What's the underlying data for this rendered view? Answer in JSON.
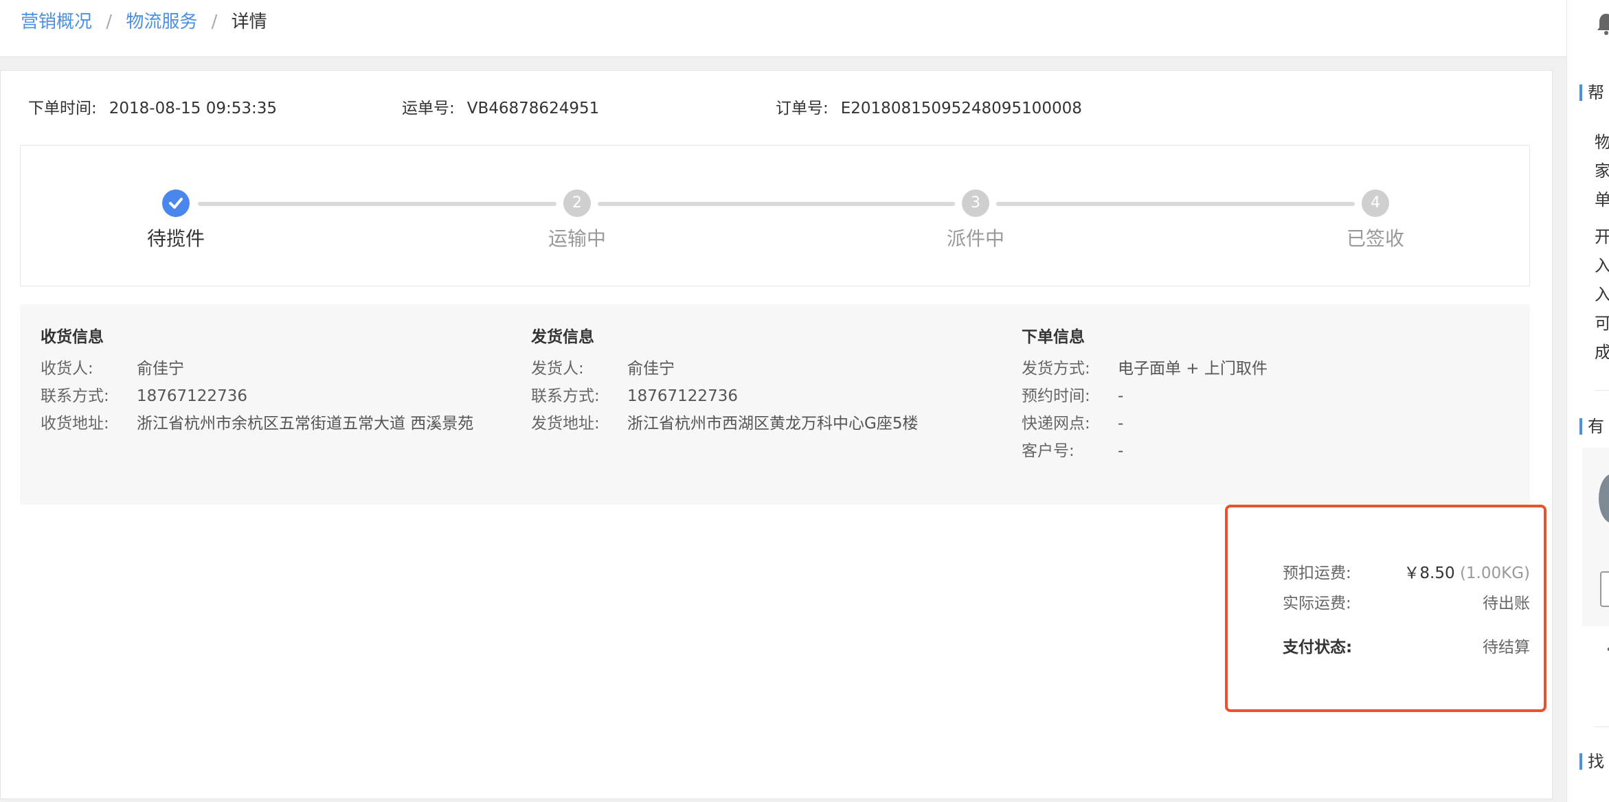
{
  "breadcrumb": {
    "items": [
      "营销概况",
      "物流服务"
    ],
    "separator": "/",
    "current": "详情"
  },
  "order_meta": {
    "order_time_label": "下单时间:",
    "order_time": "2018-08-15 09:53:35",
    "waybill_label": "运单号:",
    "waybill": "VB46878624951",
    "order_no_label": "订单号:",
    "order_no": "E20180815095248095100008"
  },
  "steps": [
    {
      "number": "✓",
      "label": "待揽件",
      "state": "active"
    },
    {
      "number": "2",
      "label": "运输中",
      "state": "pending"
    },
    {
      "number": "3",
      "label": "派件中",
      "state": "pending"
    },
    {
      "number": "4",
      "label": "已签收",
      "state": "pending"
    }
  ],
  "receiver": {
    "title": "收货信息",
    "rows": [
      {
        "k": "收货人:",
        "v": "俞佳宁"
      },
      {
        "k": "联系方式:",
        "v": "18767122736"
      },
      {
        "k": "收货地址:",
        "v": "浙江省杭州市余杭区五常街道五常大道 西溪景苑"
      }
    ]
  },
  "sender": {
    "title": "发货信息",
    "rows": [
      {
        "k": "发货人:",
        "v": "俞佳宁"
      },
      {
        "k": "联系方式:",
        "v": "18767122736"
      },
      {
        "k": "发货地址:",
        "v": "浙江省杭州市西湖区黄龙万科中心G座5楼"
      }
    ]
  },
  "order_info": {
    "title": "下单信息",
    "rows": [
      {
        "k": "发货方式:",
        "v": "电子面单 + 上门取件"
      },
      {
        "k": "预约时间:",
        "v": "-"
      },
      {
        "k": "快递网点:",
        "v": "-"
      },
      {
        "k": "客户号:",
        "v": "-"
      }
    ]
  },
  "fee": {
    "prepaid_label": "预扣运费:",
    "prepaid_value": "￥8.50",
    "prepaid_weight": "(1.00KG)",
    "actual_label": "实际运费:",
    "actual_value": "待出账",
    "pay_status_label": "支付状态:",
    "pay_status_value": "待结算"
  },
  "help_panel": {
    "title1": "帮",
    "chars1": [
      "物",
      "家",
      "单"
    ],
    "chars2": [
      "开",
      "入",
      "入",
      "可",
      "成"
    ],
    "title2": "有",
    "title3": "找"
  },
  "colors": {
    "accent": "#4a87ec",
    "highlight_border": "#e8522d"
  }
}
